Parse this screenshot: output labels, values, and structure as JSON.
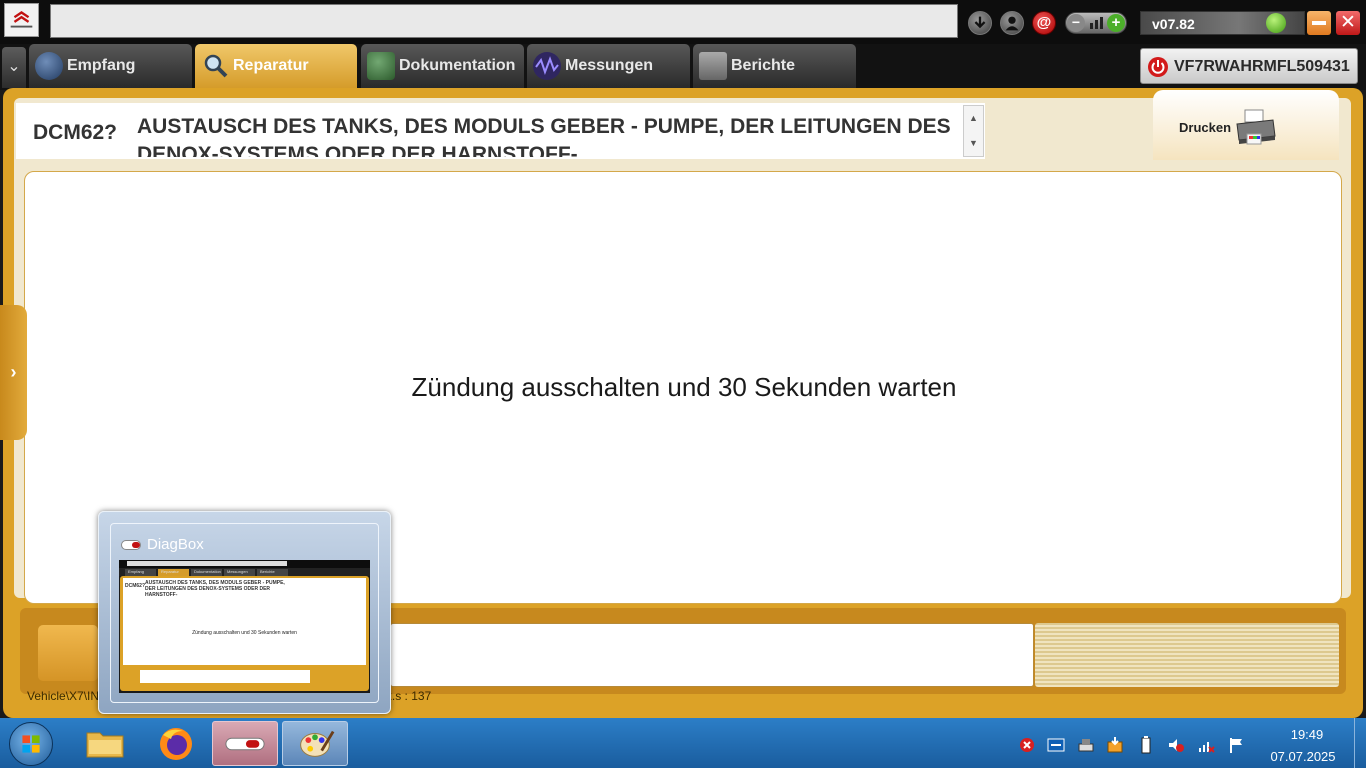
{
  "window": {
    "address_value": "",
    "version": "v07.82"
  },
  "tabs": [
    {
      "label": "Empfang",
      "active": false,
      "icon": "globe-icon"
    },
    {
      "label": "Reparatur",
      "active": true,
      "icon": "magnifier-icon"
    },
    {
      "label": "Dokumentation",
      "active": false,
      "icon": "book-icon"
    },
    {
      "label": "Messungen",
      "active": false,
      "icon": "waveform-icon"
    },
    {
      "label": "Berichte",
      "active": false,
      "icon": "report-icon"
    }
  ],
  "vin": "VF7RWAHRMFL509431",
  "procedure": {
    "code": "DCM62?",
    "title": "AUSTAUSCH DES TANKS, DES MODULS GEBER - PUMPE, DER LEITUNGEN DES DENOX-SYSTEMS ODER DER HARNSTOFF-"
  },
  "print": {
    "label": "Drucken"
  },
  "message": "Zündung ausschalten und 30 Sekunden warten",
  "script_path": "Vehicle\\X7\\IN  ...  module_jauge_pompe_ou_tuyaux_systeme_deNOx.s : 137",
  "thumbnail": {
    "title": "DiagBox",
    "mini_tabs": [
      "Empfang",
      "Reparatur",
      "Dokumentation",
      "Messungen",
      "Berichte"
    ],
    "mini_code": "DCM62?",
    "mini_title": "AUSTAUSCH DES TANKS, DES MODULS GEBER - PUMPE, DER LEITUNGEN DES DENOX-SYSTEMS ODER DER HARNSTOFF-",
    "mini_message": "Zündung ausschalten und 30 Sekunden warten"
  },
  "taskbar": {
    "apps": [
      "windows-explorer",
      "firefox",
      "diagbox",
      "paint"
    ],
    "time": "19:49",
    "date": "07.07.2025"
  },
  "colors": {
    "accent_gold": "#dca227",
    "active_tab": "#e0aa3f",
    "close_red": "#c01818",
    "taskbar_blue": "#1a5d9e"
  }
}
